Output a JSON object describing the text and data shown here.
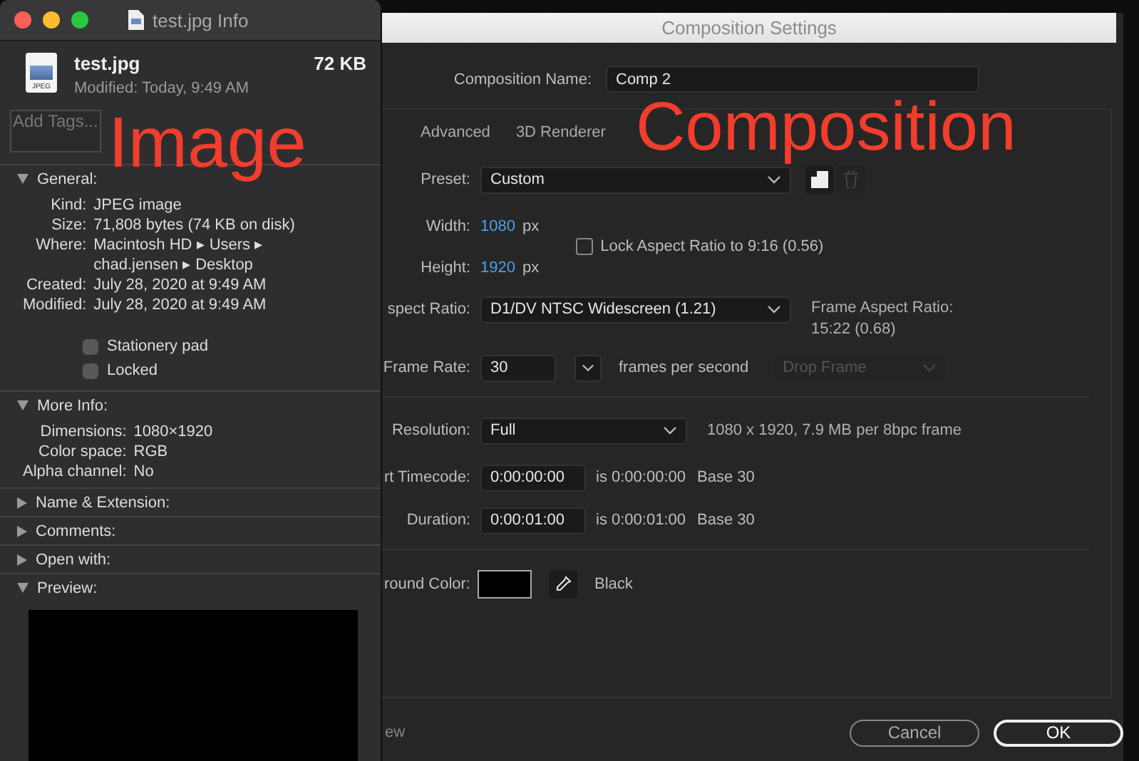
{
  "info_window": {
    "title": "test.jpg Info",
    "file_icon_label": "JPEG",
    "file_name": "test.jpg",
    "file_size": "72 KB",
    "modified": "Modified: Today, 9:49 AM",
    "tags_field": {
      "placeholder": "Add Tags..."
    },
    "annotation": "Image",
    "sections": [
      {
        "title": "General:",
        "expanded": true,
        "kind": "details",
        "rows": [
          {
            "label": "Kind:",
            "value": "JPEG image"
          },
          {
            "label": "Size:",
            "value": "71,808 bytes (74 KB on disk)"
          },
          {
            "label": "Where:",
            "value": "Macintosh HD ▸ Users ▸\nchad.jensen ▸ Desktop"
          },
          {
            "label": "Created:",
            "value": "July 28, 2020 at 9:49 AM"
          },
          {
            "label": "Modified:",
            "value": "July 28, 2020 at 9:49 AM"
          }
        ],
        "checkboxes": [
          {
            "label": "Stationery pad",
            "checked": false
          },
          {
            "label": "Locked",
            "checked": false
          }
        ]
      },
      {
        "title": "More Info:",
        "expanded": true,
        "kind": "details",
        "rows": [
          {
            "label": "Dimensions:",
            "value": "1080×1920"
          },
          {
            "label": "Color space:",
            "value": "RGB"
          },
          {
            "label": "Alpha channel:",
            "value": "No"
          }
        ]
      },
      {
        "title": "Name & Extension:",
        "expanded": false
      },
      {
        "title": "Comments:",
        "expanded": false
      },
      {
        "title": "Open with:",
        "expanded": false
      },
      {
        "title": "Preview:",
        "expanded": true,
        "kind": "preview"
      }
    ]
  },
  "composition_dialog": {
    "title": "Composition Settings",
    "annotation": "Composition",
    "name_label": "Composition Name:",
    "name_value": "Comp 2",
    "tabs": [
      {
        "label": "Advanced",
        "selected": false
      },
      {
        "label": "3D Renderer",
        "selected": false
      }
    ],
    "preset": {
      "label": "Preset:",
      "value": "Custom"
    },
    "width": {
      "label": "Width:",
      "value": "1080",
      "unit": "px"
    },
    "height": {
      "label": "Height:",
      "value": "1920",
      "unit": "px"
    },
    "lock_aspect": {
      "label": "Lock Aspect Ratio to 9:16 (0.56)",
      "checked": false
    },
    "pixel_aspect": {
      "label": "spect Ratio:",
      "value": "D1/DV NTSC Widescreen (1.21)",
      "note": "Frame Aspect Ratio:\n15:22 (0.68)"
    },
    "frame_rate": {
      "label": "Frame Rate:",
      "value": "30",
      "unit": "frames per second",
      "drop_frame": {
        "value": "Drop Frame",
        "disabled": true
      }
    },
    "resolution": {
      "label": "Resolution:",
      "value": "Full",
      "note": "1080 x 1920, 7.9 MB per 8bpc frame"
    },
    "start_timecode": {
      "label": "rt Timecode:",
      "value": "0:00:00:00",
      "note": "is 0:00:00:00",
      "base": "Base 30"
    },
    "duration": {
      "label": "Duration:",
      "value": "0:00:01:00",
      "note": "is 0:00:01:00",
      "base": "Base 30"
    },
    "background_color": {
      "label": "round Color:",
      "color": "#000000",
      "name": "Black"
    },
    "preview_label": "ew",
    "buttons": [
      {
        "label": "Cancel",
        "default": false
      },
      {
        "label": "OK",
        "default": true
      }
    ]
  }
}
